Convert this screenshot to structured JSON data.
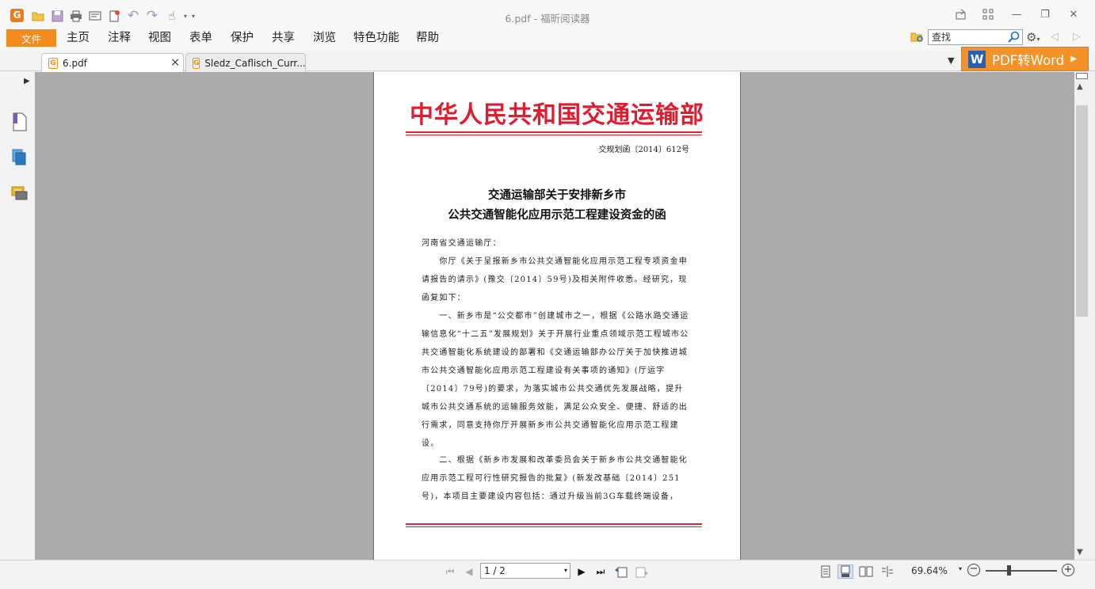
{
  "window": {
    "title": "6.pdf - 福昕阅读器",
    "minimize": "—",
    "maximize": "❐",
    "close": "✕"
  },
  "menu": {
    "file": "文件",
    "items": [
      "主页",
      "注释",
      "视图",
      "表单",
      "保护",
      "共享",
      "浏览",
      "特色功能",
      "帮助"
    ]
  },
  "search": {
    "placeholder": "查找"
  },
  "tabs": [
    {
      "label": "6.pdf",
      "icon": "pdf-icon",
      "close": "×"
    },
    {
      "label": "Sledz_Caflisch_Curr..."
    }
  ],
  "promo": {
    "label": "PDF转Word",
    "word_letter": "W"
  },
  "document": {
    "header": "中华人民共和国交通运输部",
    "number": "交规划函〔2014〕612号",
    "title_line1": "交通运输部关于安排新乡市",
    "title_line2": "公共交通智能化应用示范工程建设资金的函",
    "paragraphs": [
      "河南省交通运输厅：",
      "　　你厅《关于呈报新乡市公共交通智能化应用示范工程专项资金申请报告的请示》(豫交〔2014〕59号)及相关附件收悉。经研究，现函复如下：",
      "　　一、新乡市是“公交都市”创建城市之一，根据《公路水路交通运输信息化“十二五”发展规划》关于开展行业重点领域示范工程城市公共交通智能化系统建设的部署和《交通运输部办公厅关于加快推进城市公共交通智能化应用示范工程建设有关事项的通知》(厅运字〔2014〕79号)的要求，为落实城市公共交通优先发展战略，提升城市公共交通系统的运输服务效能，满足公众安全、便捷、舒适的出行需求，同意支持你厅开展新乡市公共交通智能化应用示范工程建设。",
      "　　二、根据《新乡市发展和改革委员会关于新乡市公共交通智能化应用示范工程可行性研究报告的批复》(新发改基础〔2014〕251号)，本项目主要建设内容包括：通过升级当前3G车载终端设备，"
    ]
  },
  "status": {
    "page": "1 / 2",
    "zoom": "69.64%"
  },
  "colors": {
    "accent": "#f28c1e",
    "doc_red": "#e01d2f",
    "word_blue": "#2b5fb3"
  }
}
